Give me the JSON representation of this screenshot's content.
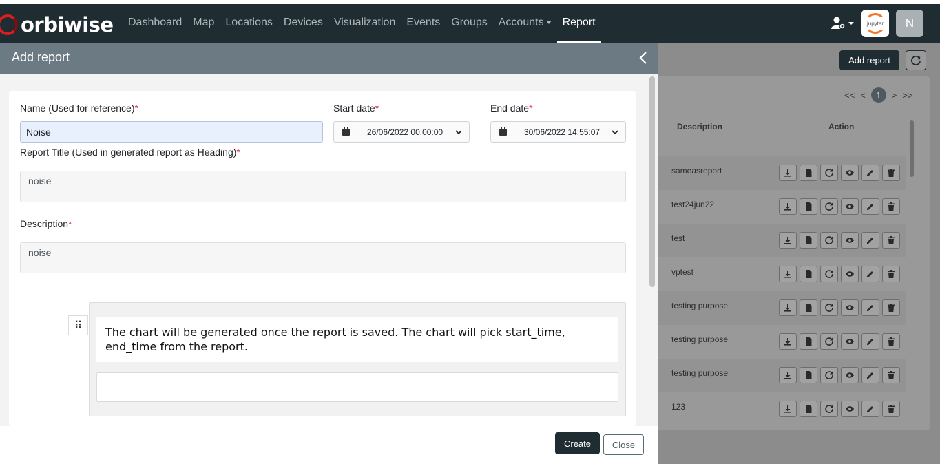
{
  "navbar": {
    "brand": "orbiwise",
    "items": [
      {
        "label": "Dashboard",
        "active": false
      },
      {
        "label": "Map",
        "active": false
      },
      {
        "label": "Locations",
        "active": false
      },
      {
        "label": "Devices",
        "active": false
      },
      {
        "label": "Visualization",
        "active": false
      },
      {
        "label": "Events",
        "active": false
      },
      {
        "label": "Groups",
        "active": false
      },
      {
        "label": "Accounts",
        "active": false,
        "dropdown": true
      },
      {
        "label": "Report",
        "active": true
      }
    ],
    "jupyter_label": "jupyter",
    "avatar_initial": "N"
  },
  "background": {
    "add_report_label": "Add report",
    "pager": {
      "first": "<<",
      "prev": "<",
      "current": "1",
      "next": ">",
      "last": ">>"
    },
    "columns": {
      "description": "Description",
      "action": "Action"
    },
    "rows": [
      {
        "description": "sameasreport"
      },
      {
        "description": "test24jun22"
      },
      {
        "description": "test"
      },
      {
        "description": "vptest"
      },
      {
        "description": "testing purpose"
      },
      {
        "description": "testing purpose"
      },
      {
        "description": "testing purpose"
      },
      {
        "description": "123"
      }
    ]
  },
  "panel": {
    "title": "Add report",
    "name_label": "Name (Used for reference)",
    "name_value": "Noise",
    "start_label": "Start date",
    "start_value": "26/06/2022 00:00:00",
    "end_label": "End date",
    "end_value": "30/06/2022 14:55:07",
    "report_title_label": "Report Title (Used in generated report as Heading)",
    "report_title_value": "noise",
    "description_label": "Description",
    "description_value": "noise",
    "required_mark": "*",
    "chart_note": "The chart will be generated once the report is saved. The chart will pick start_time, end_time from the report.",
    "create_label": "Create",
    "close_label": "Close"
  },
  "colors": {
    "navbar": "#1f2d33",
    "panel_header": "#6c7a83",
    "required": "#dc3545",
    "brand_accent": "#d81e1e"
  }
}
